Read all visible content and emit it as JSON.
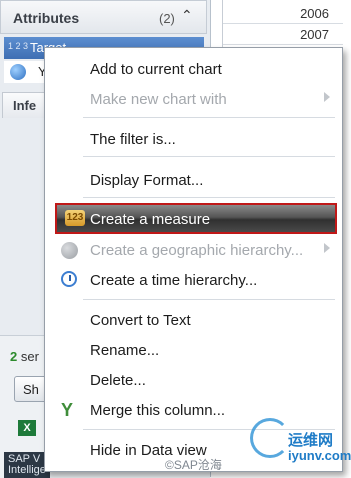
{
  "attributes_panel": {
    "title": "Attributes",
    "count": "(2)",
    "items": [
      {
        "label": "Target",
        "tag": "1 2 3"
      },
      {
        "label": "Y"
      }
    ],
    "info_tab": "Infe",
    "selection_count_number": "2",
    "selection_count_text": " ser",
    "show_button": "Sh",
    "excel_icon": "X",
    "app_caption": "SAP V\nIntellige"
  },
  "year_table": {
    "rows": [
      "2006",
      "2007"
    ]
  },
  "context_menu": {
    "items": [
      {
        "label": "Add to current chart",
        "enabled": true
      },
      {
        "label": "Make new chart with",
        "enabled": false,
        "submenu": true
      },
      {
        "label": "The filter is...",
        "enabled": true
      },
      {
        "label": "Display Format...",
        "enabled": true
      },
      {
        "label": "Create a measure",
        "enabled": true,
        "highlighted": true,
        "icon": "measure-icon"
      },
      {
        "label": "Create a geographic hierarchy...",
        "enabled": false,
        "submenu": true,
        "icon": "globe-icon"
      },
      {
        "label": "Create a time hierarchy...",
        "enabled": true,
        "icon": "clock-icon"
      },
      {
        "label": "Convert to Text",
        "enabled": true
      },
      {
        "label": "Rename...",
        "enabled": true
      },
      {
        "label": "Delete...",
        "enabled": true
      },
      {
        "label": "Merge this column...",
        "enabled": true,
        "icon": "merge-icon"
      },
      {
        "label": "Hide in Data view",
        "enabled": true
      }
    ],
    "highlight_border_color": "#c01818",
    "measure_icon_glyph": "123",
    "merge_icon_glyph": "Y"
  },
  "watermark": {
    "site_name": "运维网",
    "site_url": "iyunv.com",
    "credit": "©SAP沧海"
  }
}
